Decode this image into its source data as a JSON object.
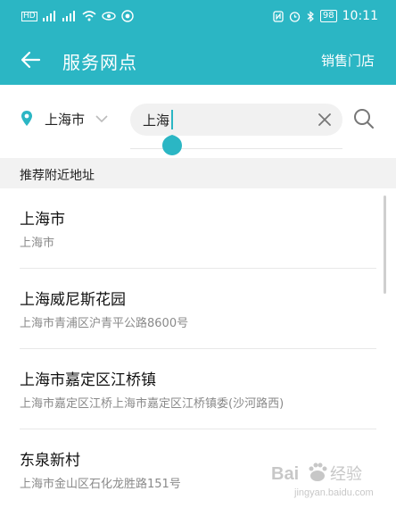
{
  "status_bar": {
    "left_icons": [
      "hd-icon",
      "signal-4g-icon",
      "signal-4g-icon",
      "wifi-icon",
      "eye-icon",
      "chat-icon"
    ],
    "battery": "98",
    "time": "10:11"
  },
  "header": {
    "title": "服务网点",
    "right_action": "销售门店",
    "color": "#2bb6c4"
  },
  "search": {
    "city": "上海市",
    "query": "上海"
  },
  "section": {
    "title": "推荐附近地址"
  },
  "results": [
    {
      "name": "上海市",
      "address": "上海市"
    },
    {
      "name": "上海威尼斯花园",
      "address": "上海市青浦区沪青平公路8600号"
    },
    {
      "name": "上海市嘉定区江桥镇",
      "address": "上海市嘉定区江桥上海市嘉定区江桥镇委(沙河路西)"
    },
    {
      "name": "东泉新村",
      "address": "上海市金山区石化龙胜路151号"
    }
  ],
  "watermark": {
    "brand": "Bai",
    "brand2": "经验",
    "url": "jingyan.baidu.com"
  }
}
